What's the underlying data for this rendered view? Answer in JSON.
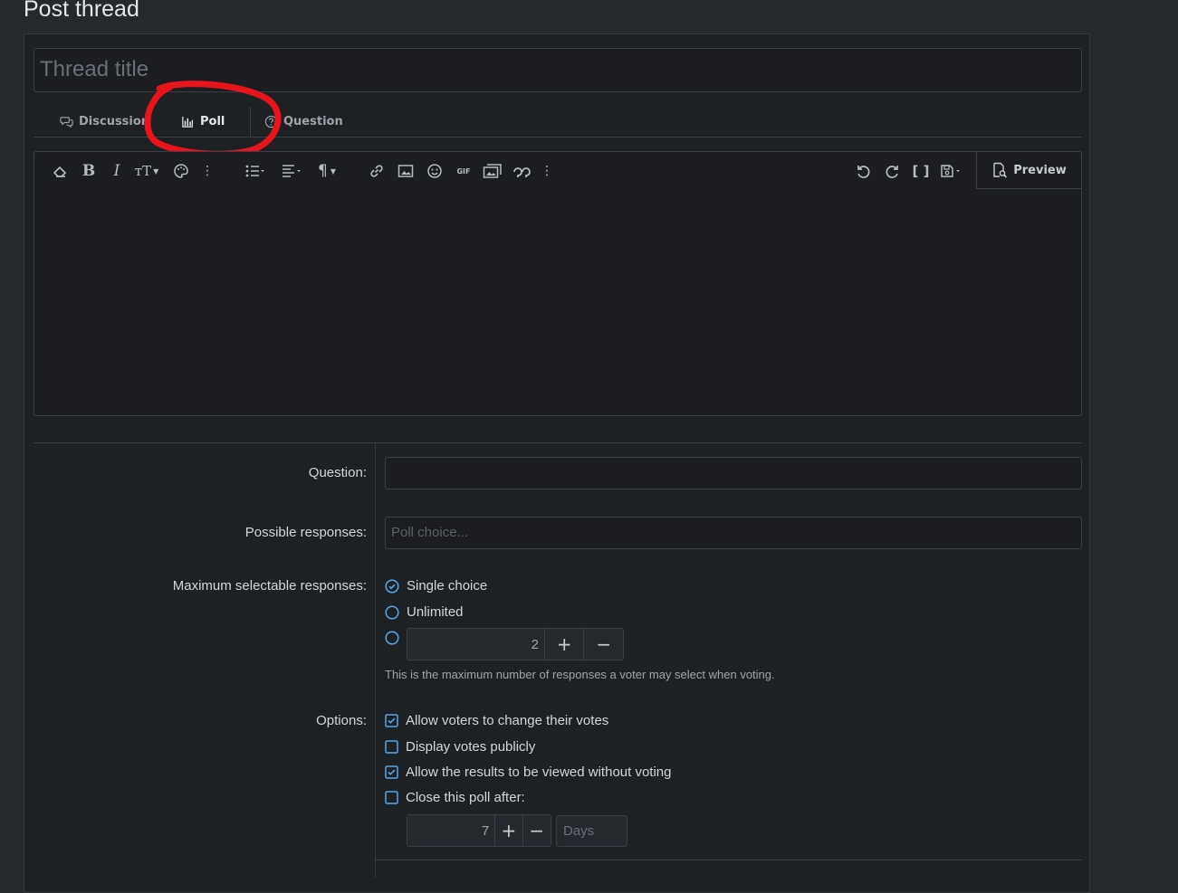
{
  "page": {
    "title": "Post thread"
  },
  "thread": {
    "title_placeholder": "Thread title"
  },
  "tabs": [
    {
      "label": "Discussion",
      "icon": "comments-icon"
    },
    {
      "label": "Poll",
      "icon": "bar-chart-icon",
      "active": true
    },
    {
      "label": "Question",
      "icon": "question-circle-icon"
    }
  ],
  "annotation": {
    "color": "#e8141c"
  },
  "editor": {
    "toolbar_left": [
      "eraser-icon",
      "bold-icon",
      "italic-icon",
      "text-size-icon",
      "palette-icon",
      "more-vertical-icon",
      "list-icon",
      "align-icon",
      "paragraph-icon",
      "link-icon",
      "image-icon",
      "smile-icon",
      "gif-icon",
      "media-icon",
      "quote-icon",
      "more-vertical-icon"
    ],
    "toolbar_right": [
      "undo-icon",
      "redo-icon",
      "brackets-icon",
      "save-draft-icon"
    ],
    "gif_label": "GIF",
    "preview_label": "Preview"
  },
  "poll": {
    "question_label": "Question:",
    "responses_label": "Possible responses:",
    "responses_placeholder": "Poll choice...",
    "max_label": "Maximum selectable responses:",
    "max_options": [
      {
        "label": "Single choice",
        "checked": true
      },
      {
        "label": "Unlimited",
        "checked": false
      }
    ],
    "max_custom_value": "2",
    "max_hint": "This is the maximum number of responses a voter may select when voting.",
    "options_label": "Options:",
    "options": [
      {
        "label": "Allow voters to change their votes",
        "checked": true
      },
      {
        "label": "Display votes publicly",
        "checked": false
      },
      {
        "label": "Allow the results to be viewed without voting",
        "checked": true
      },
      {
        "label": "Close this poll after:",
        "checked": false
      }
    ],
    "close_value": "7",
    "close_unit_placeholder": "Days",
    "plus": "+",
    "minus": "−"
  },
  "colors": {
    "accent": "#5aa6e6",
    "background": "#25282c",
    "panel": "#1e2124"
  }
}
